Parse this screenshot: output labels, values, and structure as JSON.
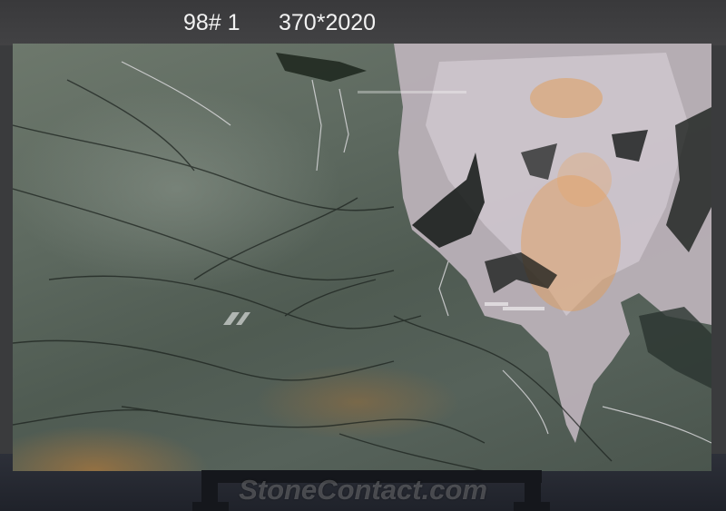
{
  "header": {
    "slab_number": "98# 1",
    "dimensions": "370*2020"
  },
  "image": {
    "subject": "marble-slab",
    "watermark": "StoneContact.com",
    "colors": {
      "background": "#3a3b3d",
      "slab_green": "#5e6a60",
      "vein_white": "#e8e6ea",
      "vein_dark": "#141716",
      "rust_tone": "#a8763c",
      "orange_glow": "#e49b52",
      "stand": "#15171c"
    }
  }
}
